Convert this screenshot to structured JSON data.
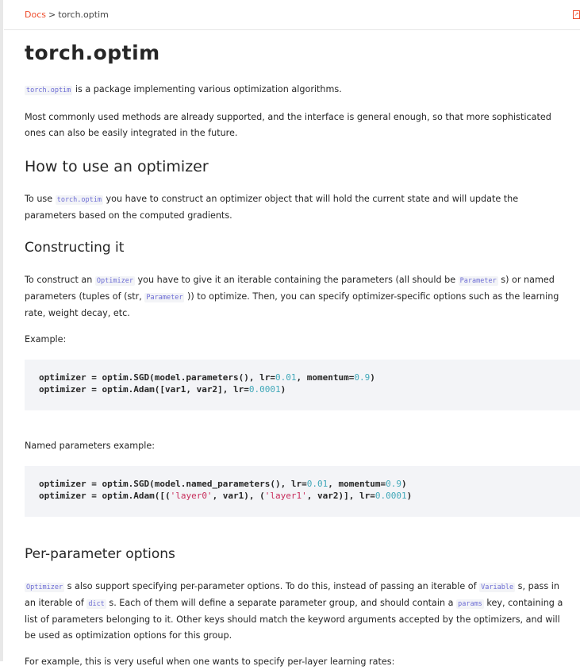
{
  "breadcrumb": {
    "root": "Docs",
    "separator": ">",
    "current": "torch.optim",
    "external_icon_glyph": "↗"
  },
  "title": "torch.optim",
  "intro": {
    "code": "torch.optim",
    "text": " is a package implementing various optimization algorithms."
  },
  "p_methods": "Most commonly used methods are already supported, and the interface is general enough, so that more sophisticated ones can also be easily integrated in the future.",
  "how_to": {
    "heading": "How to use an optimizer",
    "pre": "To use ",
    "code": "torch.optim",
    "post": " you have to construct an optimizer object that will hold the current state and will update the parameters based on the computed gradients."
  },
  "constructing": {
    "heading": "Constructing it",
    "s1": "To construct an ",
    "c1": "Optimizer",
    "s2": " you have to give it an iterable containing the parameters (all should be ",
    "c2": "Parameter",
    "s3": " s) or named parameters (tuples of (str, ",
    "c3": "Parameter",
    "s4": " )) to optimize. Then, you can specify optimizer-specific options such as the learning rate, weight decay, etc.",
    "example_label": "Example:",
    "code1": {
      "line1": {
        "a": "optimizer = optim.SGD(model.parameters(), lr=",
        "n1": "0.01",
        "b": ", momentum=",
        "n2": "0.9",
        "c": ")"
      },
      "line2": {
        "a": "optimizer = optim.Adam([var1, var2], lr=",
        "n1": "0.0001",
        "b": ")"
      }
    },
    "named_label": "Named parameters example:",
    "code2": {
      "line1": {
        "a": "optimizer = optim.SGD(model.named_parameters(), lr=",
        "n1": "0.01",
        "b": ", momentum=",
        "n2": "0.9",
        "c": ")"
      },
      "line2": {
        "a": "optimizer = optim.Adam([(",
        "s1": "'layer0'",
        "b": ", var1), (",
        "s2": "'layer1'",
        "c": ", var2)], lr=",
        "n1": "0.0001",
        "d": ")"
      }
    }
  },
  "per_param": {
    "heading": "Per-parameter options",
    "c1": "Optimizer",
    "s1": " s also support specifying per-parameter options. To do this, instead of passing an iterable of ",
    "c2": "Variable",
    "s2": " s, pass in an iterable of ",
    "c3": "dict",
    "s3": " s. Each of them will define a separate parameter group, and should contain a ",
    "c4": "params",
    "s4": " key, containing a list of parameters belonging to it. Other keys should match the keyword arguments accepted by the optimizers, and will be used as optimization options for this group.",
    "next_partial": "For example, this is very useful when one wants to specify per-layer learning rates:"
  },
  "colors": {
    "accent": "#ee4c2c",
    "inline_code": "#6c6cd4",
    "code_bg": "#f3f4f7",
    "number": "#3fa7b8",
    "string": "#c72d5b"
  }
}
